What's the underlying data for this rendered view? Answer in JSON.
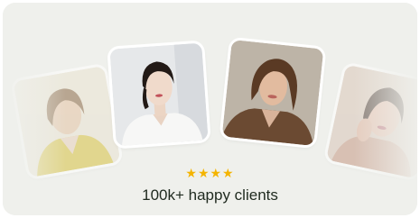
{
  "testimonial": {
    "rating_stars": "★★★★",
    "tagline": "100k+ happy clients",
    "star_color": "#f4b400"
  },
  "photos": [
    {
      "name": "client-photo-1"
    },
    {
      "name": "client-photo-2"
    },
    {
      "name": "client-photo-3"
    },
    {
      "name": "client-photo-4"
    }
  ]
}
